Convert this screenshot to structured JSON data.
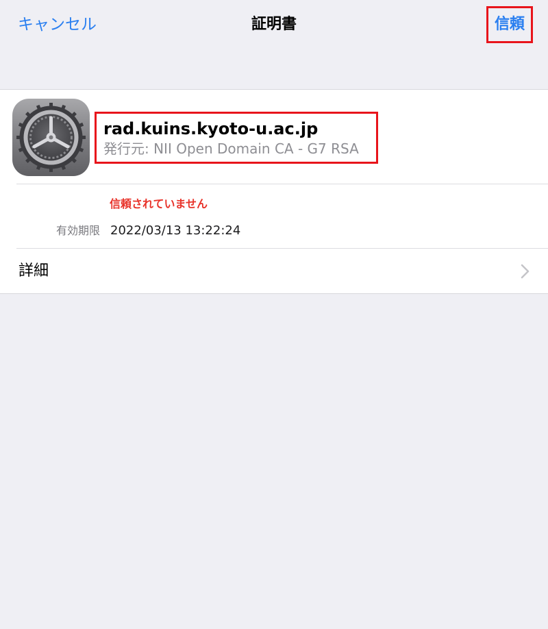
{
  "navbar": {
    "cancel_label": "キャンセル",
    "title": "証明書",
    "trust_label": "信頼"
  },
  "certificate": {
    "icon": "settings-gear-icon",
    "name": "rad.kuins.kyoto-u.ac.jp",
    "issuer": "発行元: NII Open Domain CA - G7 RSA",
    "status": "信頼されていません",
    "expires_label": "有効期限",
    "expires_value": "2022/03/13 13:22:24"
  },
  "details": {
    "label": "詳細",
    "icon": "chevron-right-icon"
  },
  "colors": {
    "accent": "#2a7ff0",
    "warning": "#e8332a",
    "highlight_box": "#e8141b",
    "background": "#efeff4"
  }
}
